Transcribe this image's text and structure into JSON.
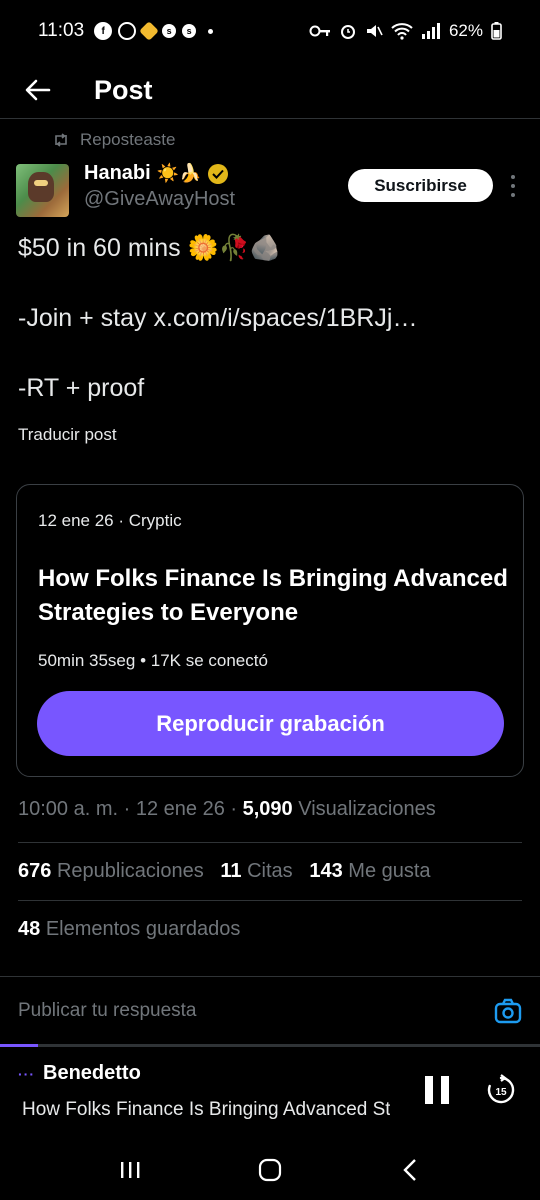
{
  "status_bar": {
    "time": "11:03",
    "battery": "62%"
  },
  "header": {
    "title": "Post"
  },
  "repost": {
    "label": "Reposteaste"
  },
  "author": {
    "name": "Hanabi",
    "name_emoji": "☀️🍌",
    "handle": "@GiveAwayHost"
  },
  "subscribe_label": "Suscribirse",
  "post": {
    "line1": "$50 in 60 mins 🌼🥀🪨",
    "line2_prefix": "-Join + stay ",
    "line2_link": "x.com/i/spaces/1BRJj…",
    "line3": "-RT + proof",
    "translate": "Traducir post"
  },
  "space_card": {
    "meta": "12 ene 26 · Cryptic",
    "title": "How Folks Finance Is Bringing Advanced Strategies to Everyone",
    "stats": "50min 35seg • 17K se conectó",
    "play_label": "Reproducir grabación"
  },
  "post_info": {
    "time": "10:00 a. m.",
    "date": "12 ene 26",
    "views_count": "5,090",
    "views_label": "Visualizaciones"
  },
  "engagement": {
    "reposts_count": "676",
    "reposts_label": "Republicaciones",
    "quotes_count": "11",
    "quotes_label": "Citas",
    "likes_count": "143",
    "likes_label": "Me gusta",
    "bookmarks_count": "48",
    "bookmarks_label": "Elementos guardados"
  },
  "reply": {
    "placeholder": "Publicar tu respuesta"
  },
  "player": {
    "host": "Benedetto",
    "title": "How Folks Finance Is Bringing Advanced Strategies to Everyone",
    "skip_seconds": "15",
    "progress": 0.07,
    "accent": "#7856ff"
  },
  "icons": [
    "back-arrow-icon",
    "repost-icon",
    "verified-badge-icon",
    "more-icon",
    "camera-icon",
    "pause-icon",
    "skip-forward-icon",
    "recent-apps-icon",
    "home-icon",
    "nav-back-icon"
  ]
}
